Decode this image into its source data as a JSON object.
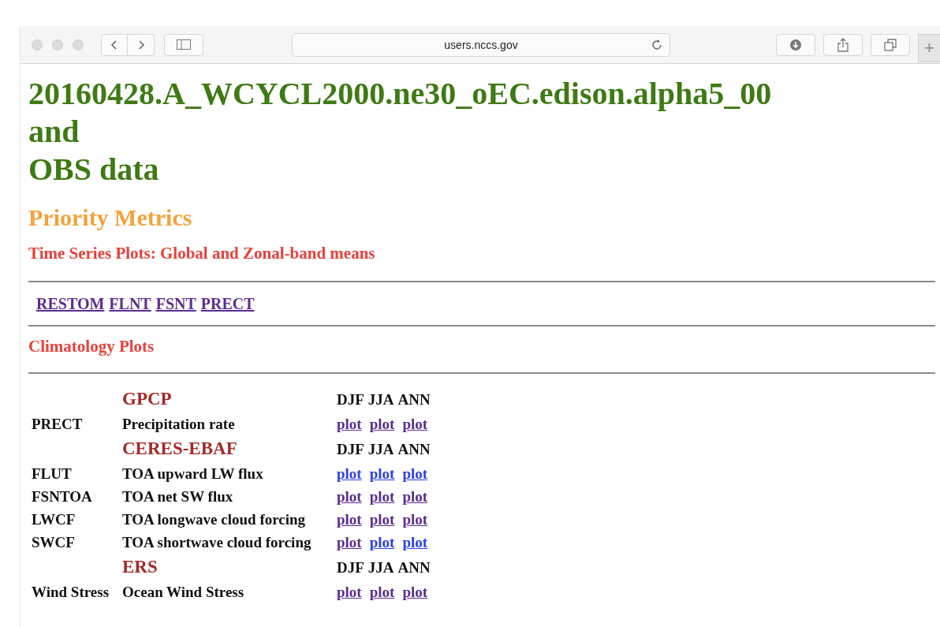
{
  "browser": {
    "address": "users.nccs.gov",
    "new_tab": "+"
  },
  "page": {
    "title_lines": [
      "20160428.A_WCYCL2000.ne30_oEC.edison.alpha5_00",
      "and",
      "OBS data"
    ],
    "priority_heading": "Priority Metrics",
    "time_series_heading": "Time Series Plots: Global and Zonal-band means",
    "time_series_links": [
      {
        "label": "RESTOM",
        "visited": true
      },
      {
        "label": "FLNT",
        "visited": true
      },
      {
        "label": "FSNT",
        "visited": true
      },
      {
        "label": "PRECT",
        "visited": true
      }
    ],
    "climatology_heading": "Climatology Plots",
    "climatology_groups": [
      {
        "source": "GPCP",
        "seasons": [
          "DJF",
          "JJA",
          "ANN"
        ],
        "rows": [
          {
            "variable": "PRECT",
            "description": "Precipitation rate",
            "plots": [
              {
                "label": "plot",
                "visited": true
              },
              {
                "label": "plot",
                "visited": true
              },
              {
                "label": "plot",
                "visited": true
              }
            ]
          }
        ]
      },
      {
        "source": "CERES-EBAF",
        "seasons": [
          "DJF",
          "JJA",
          "ANN"
        ],
        "rows": [
          {
            "variable": "FLUT",
            "description": "TOA upward LW flux",
            "plots": [
              {
                "label": "plot",
                "visited": false
              },
              {
                "label": "plot",
                "visited": false
              },
              {
                "label": "plot",
                "visited": false
              }
            ]
          },
          {
            "variable": "FSNTOA",
            "description": "TOA net SW flux",
            "plots": [
              {
                "label": "plot",
                "visited": true
              },
              {
                "label": "plot",
                "visited": true
              },
              {
                "label": "plot",
                "visited": true
              }
            ]
          },
          {
            "variable": "LWCF",
            "description": "TOA longwave cloud forcing",
            "plots": [
              {
                "label": "plot",
                "visited": true
              },
              {
                "label": "plot",
                "visited": true
              },
              {
                "label": "plot",
                "visited": true
              }
            ]
          },
          {
            "variable": "SWCF",
            "description": "TOA shortwave cloud forcing",
            "plots": [
              {
                "label": "plot",
                "visited": true
              },
              {
                "label": "plot",
                "visited": false
              },
              {
                "label": "plot",
                "visited": false
              }
            ]
          }
        ]
      },
      {
        "source": "ERS",
        "seasons": [
          "DJF",
          "JJA",
          "ANN"
        ],
        "rows": [
          {
            "variable": "Wind Stress",
            "description": "Ocean Wind Stress",
            "plots": [
              {
                "label": "plot",
                "visited": true
              },
              {
                "label": "plot",
                "visited": true
              },
              {
                "label": "plot",
                "visited": true
              }
            ]
          }
        ]
      }
    ]
  }
}
